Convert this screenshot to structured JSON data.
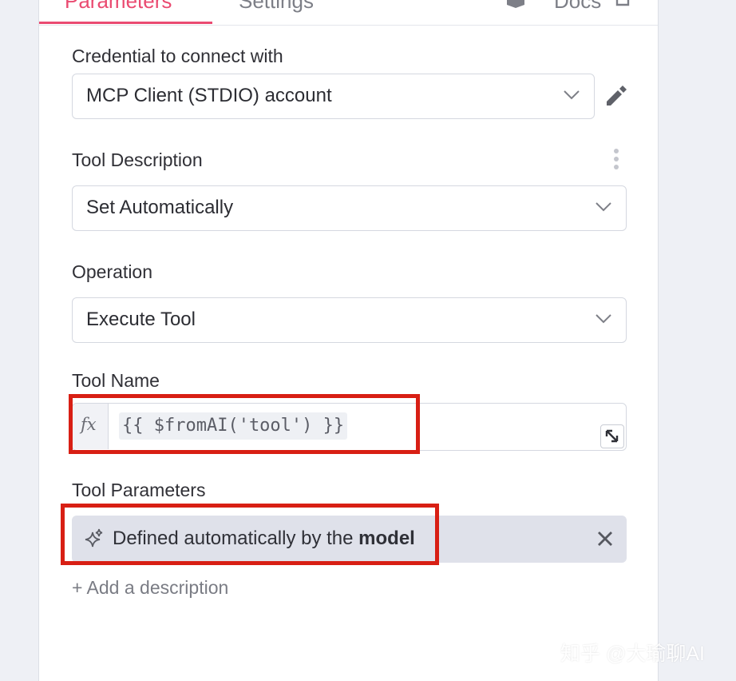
{
  "tabs": {
    "parameters": "Parameters",
    "settings": "Settings",
    "docs": "Docs"
  },
  "credential": {
    "label": "Credential to connect with",
    "value": "MCP Client (STDIO) account"
  },
  "tool_description": {
    "label": "Tool Description",
    "value": "Set Automatically"
  },
  "operation": {
    "label": "Operation",
    "value": "Execute Tool"
  },
  "tool_name": {
    "label": "Tool Name",
    "fx": "fx",
    "expression": "{{ $fromAI('tool') }}"
  },
  "tool_parameters": {
    "label": "Tool Parameters",
    "chip_prefix": "Defined automatically by the ",
    "chip_bold": "model"
  },
  "add_description": "+ Add a description",
  "watermark": "知乎 @大瑜聊AI",
  "colors": {
    "accent": "#ea4b71",
    "highlight": "#d81f14",
    "chip_bg": "#dfe1ea"
  }
}
